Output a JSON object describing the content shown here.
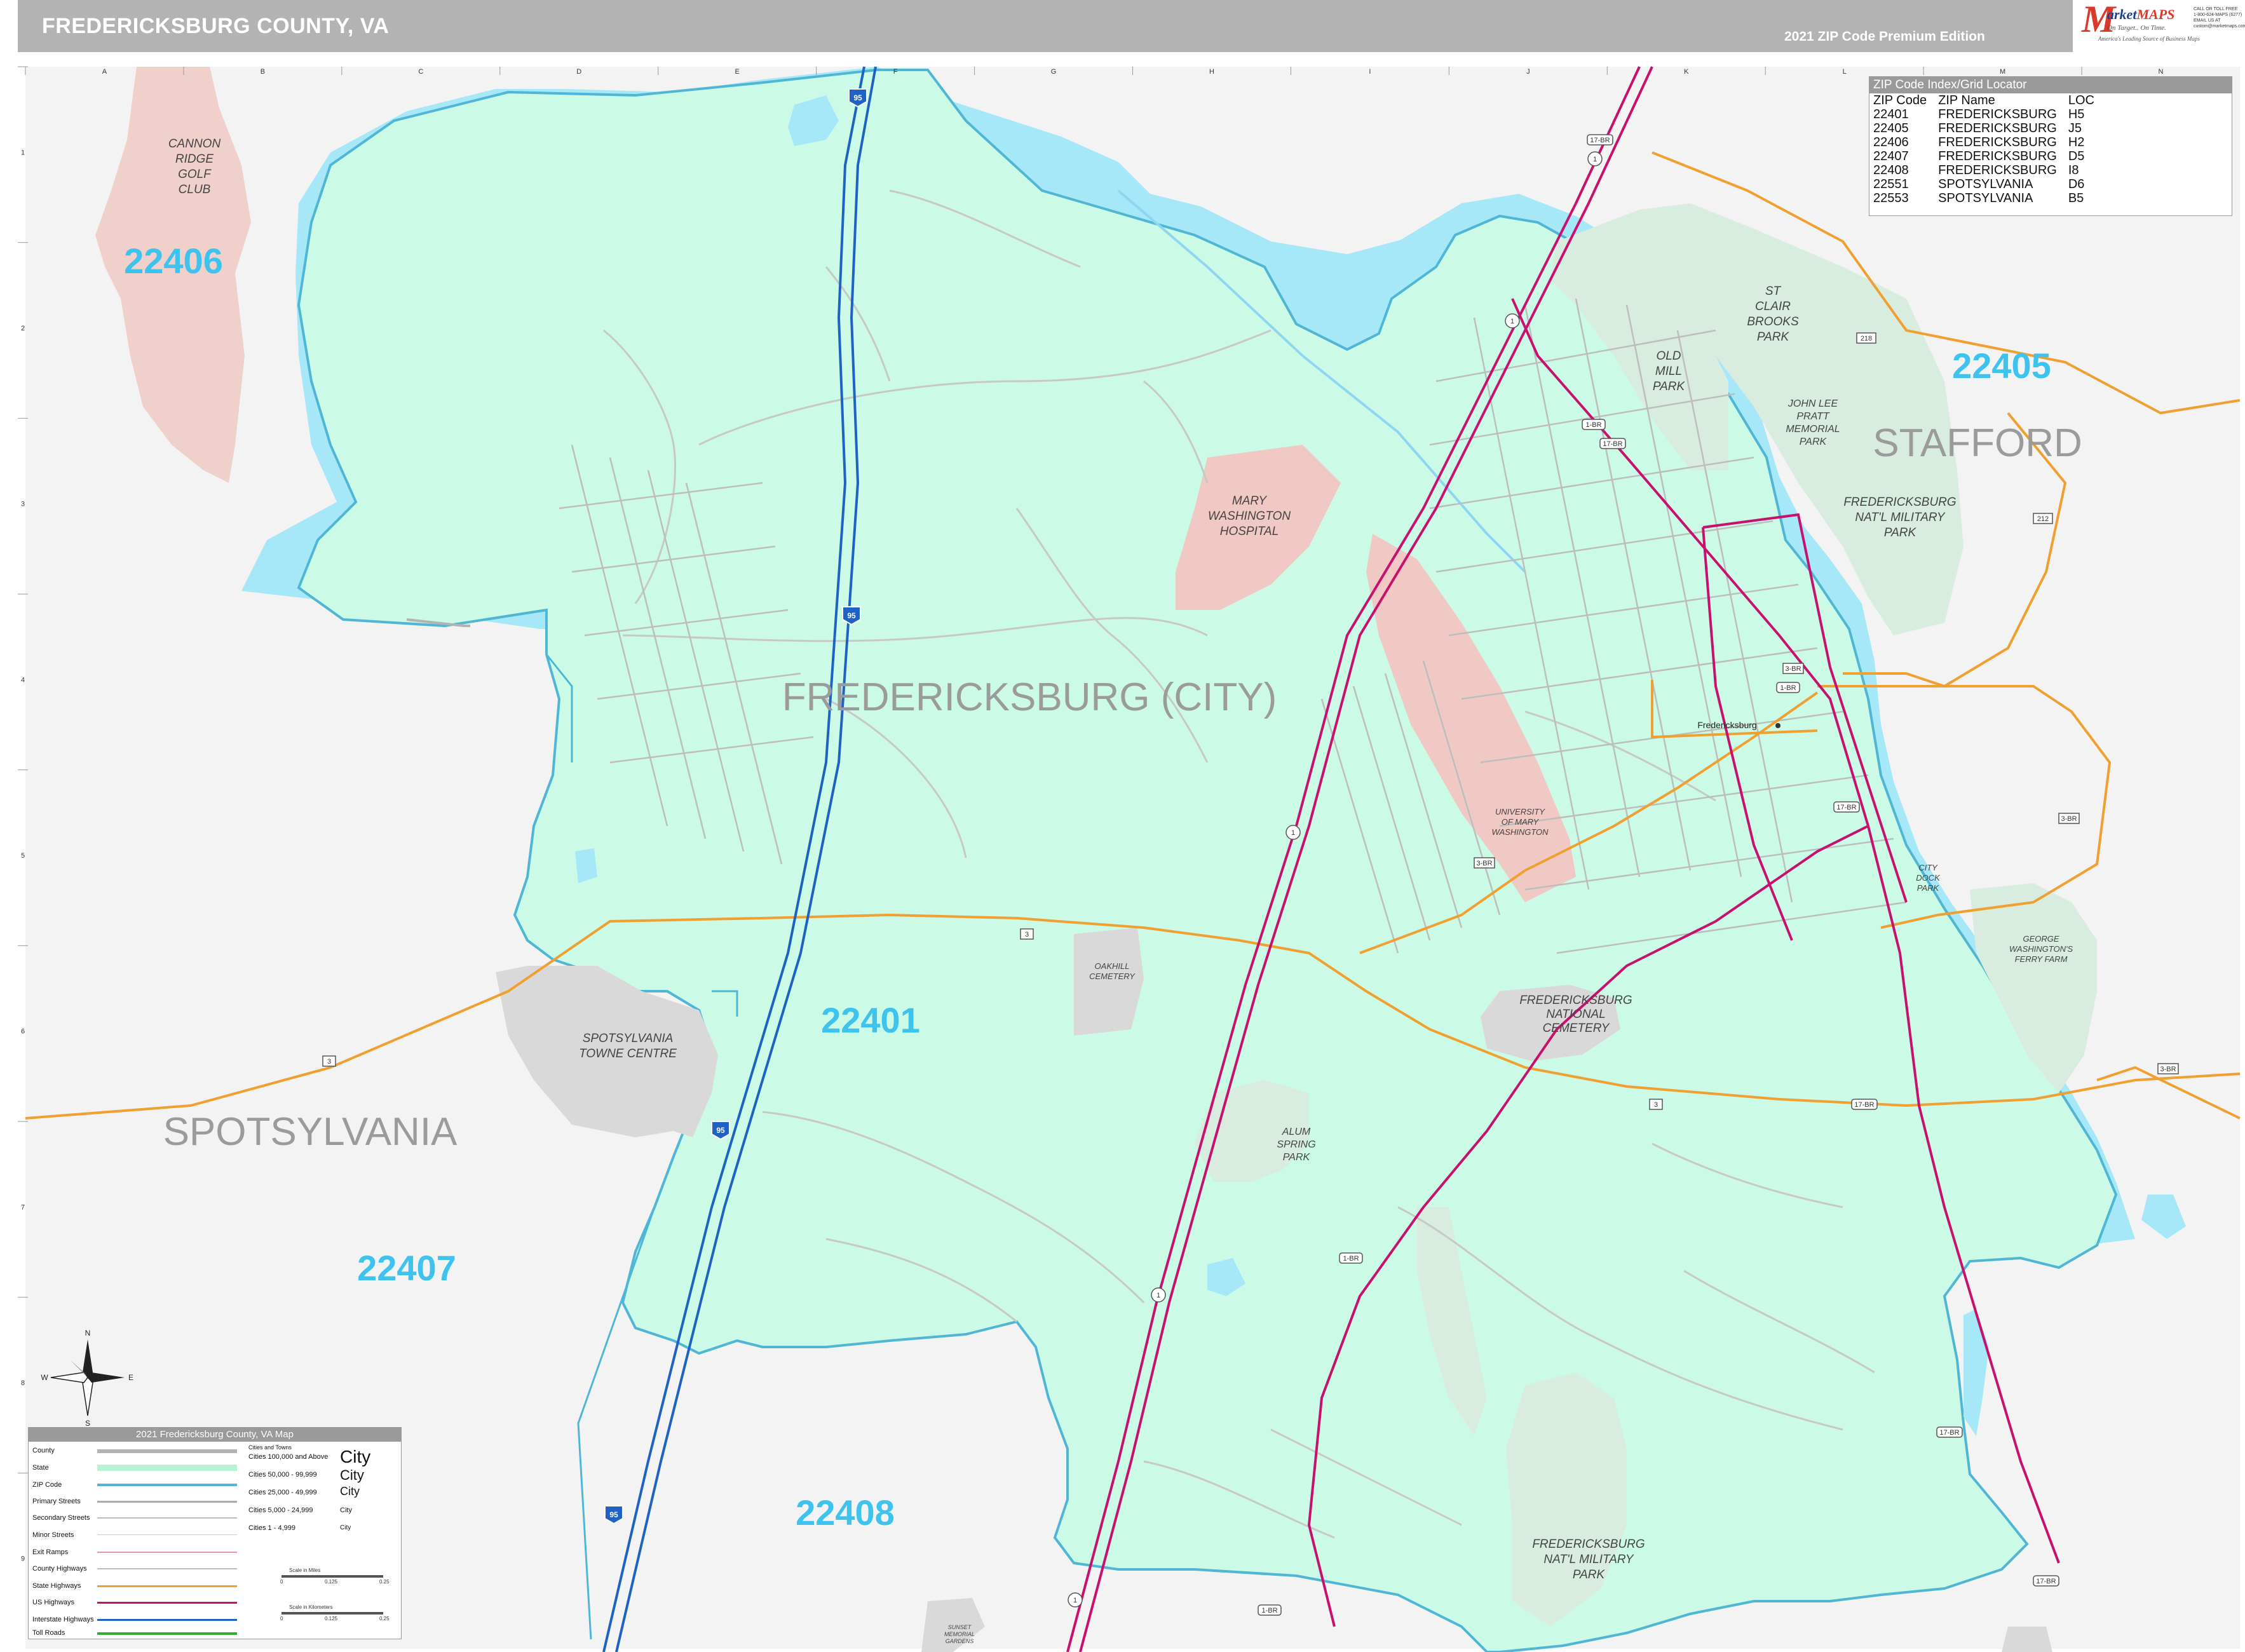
{
  "header": {
    "title": "FREDERICKSBURG COUNTY, VA",
    "edition": "2021 ZIP Code Premium Edition"
  },
  "logo": {
    "m": "M",
    "name": "MAPS",
    "top_word": "arket",
    "tagline1": "On Target.. On Time.",
    "tagline2": "America's Leading Source of Business Maps",
    "contact": "CALL OR TOLL FREE\n1-800-624-MAPS (6277)\nEMAIL US AT\ncustom@marketmaps.com"
  },
  "grid": {
    "columns": [
      "A",
      "B",
      "C",
      "D",
      "E",
      "F",
      "G",
      "H",
      "I",
      "J",
      "K",
      "L",
      "M",
      "N"
    ],
    "rows": [
      "1",
      "2",
      "3",
      "4",
      "5",
      "6",
      "7",
      "8",
      "9"
    ]
  },
  "colors": {
    "zip_fill": "#cbfbe6",
    "outside": "#f3f3f3",
    "water": "#a6e8f7",
    "park": "#d8ece0",
    "institution": "#f0c9c4",
    "commercial": "#d9d9d9",
    "zip_border": "#4fb6d6",
    "interstate": "#1e63c4",
    "us_highway": "#c8106e",
    "state_highway": "#f0a030",
    "zip_label": "#3ec3ef",
    "area_label": "#9b9b9b"
  },
  "zip_labels": [
    "22406",
    "22405",
    "22401",
    "22407",
    "22408"
  ],
  "area_labels": {
    "city": "FREDERICKSBURG (CITY)",
    "stafford": "STAFFORD",
    "spotsylvania": "SPOTSYLVANIA"
  },
  "places": {
    "cannon_ridge": [
      "CANNON",
      "RIDGE",
      "GOLF",
      "CLUB"
    ],
    "st_clair": [
      "ST",
      "CLAIR",
      "BROOKS",
      "PARK"
    ],
    "old_mill": [
      "OLD",
      "MILL",
      "PARK"
    ],
    "john_lee_pratt": [
      "JOHN LEE",
      "PRATT",
      "MEMORIAL",
      "PARK"
    ],
    "military_park_north": [
      "FREDERICKSBURG",
      "NAT'L MILITARY",
      "PARK"
    ],
    "hospital": [
      "MARY",
      "WASHINGTON",
      "HOSPITAL"
    ],
    "umw": [
      "UNIVERSITY",
      "OF MARY",
      "WASHINGTON"
    ],
    "oakhill": [
      "OAKHILL",
      "CEMETERY"
    ],
    "spotsylvania_towne": [
      "SPOTSYLVANIA",
      "TOWNE CENTRE"
    ],
    "national_cemetery": [
      "FREDERICKSBURG",
      "NATIONAL",
      "CEMETERY"
    ],
    "alum_spring": [
      "ALUM",
      "SPRING",
      "PARK"
    ],
    "city_dock": [
      "CITY",
      "DOCK",
      "PARK"
    ],
    "ferry_farm": [
      "GEORGE",
      "WASHINGTON'S",
      "FERRY FARM"
    ],
    "military_park_south": [
      "FREDERICKSBURG",
      "NAT'L MILITARY",
      "PARK"
    ],
    "downtown": "Fredericksburg",
    "sunset_cemetery": [
      "SUNSET",
      "MEMORIAL",
      "GARDENS"
    ]
  },
  "road_shields": {
    "i95": "95",
    "us1": "1",
    "us17": "17",
    "us17bus": "17-BR",
    "us1bus": "1-BR",
    "va3": "3",
    "va3bus": "3-BR",
    "va218": "218",
    "va212": "212"
  },
  "zip_index": {
    "title": "ZIP Code Index/Grid Locator",
    "headers": [
      "ZIP Code",
      "ZIP Name",
      "LOC"
    ],
    "rows": [
      [
        "22401",
        "FREDERICKSBURG",
        "H5"
      ],
      [
        "22405",
        "FREDERICKSBURG",
        "J5"
      ],
      [
        "22406",
        "FREDERICKSBURG",
        "H2"
      ],
      [
        "22407",
        "FREDERICKSBURG",
        "D5"
      ],
      [
        "22408",
        "FREDERICKSBURG",
        "I8"
      ],
      [
        "22551",
        "SPOTSYLVANIA",
        "D6"
      ],
      [
        "22553",
        "SPOTSYLVANIA",
        "B5"
      ]
    ]
  },
  "compass": {
    "n": "N",
    "s": "S",
    "e": "E",
    "w": "W"
  },
  "legend": {
    "title": "2021 Fredericksburg County, VA Map",
    "items": [
      "County",
      "State",
      "ZIP Code",
      "Primary Streets",
      "Secondary Streets",
      "Minor Streets",
      "Exit Ramps",
      "County Highways",
      "State Highways",
      "US Highways",
      "Interstate Highways",
      "Toll Roads"
    ],
    "cities_heading": "Cities and Towns",
    "cities": [
      "Cities 100,000 and Above",
      "Cities 50,000 - 99,999",
      "Cities 25,000 - 49,999",
      "Cities 5,000 - 24,999",
      "Cities 1 - 4,999"
    ],
    "city_samples": [
      "City",
      "City",
      "City",
      "City",
      "City"
    ],
    "scale_miles_title": "Scale in Miles",
    "scale_km_title": "Scale in Kilometers",
    "scale_miles": [
      "0",
      "0.125",
      "0.25"
    ],
    "scale_km": [
      "0",
      "0.125",
      "0.25"
    ]
  }
}
